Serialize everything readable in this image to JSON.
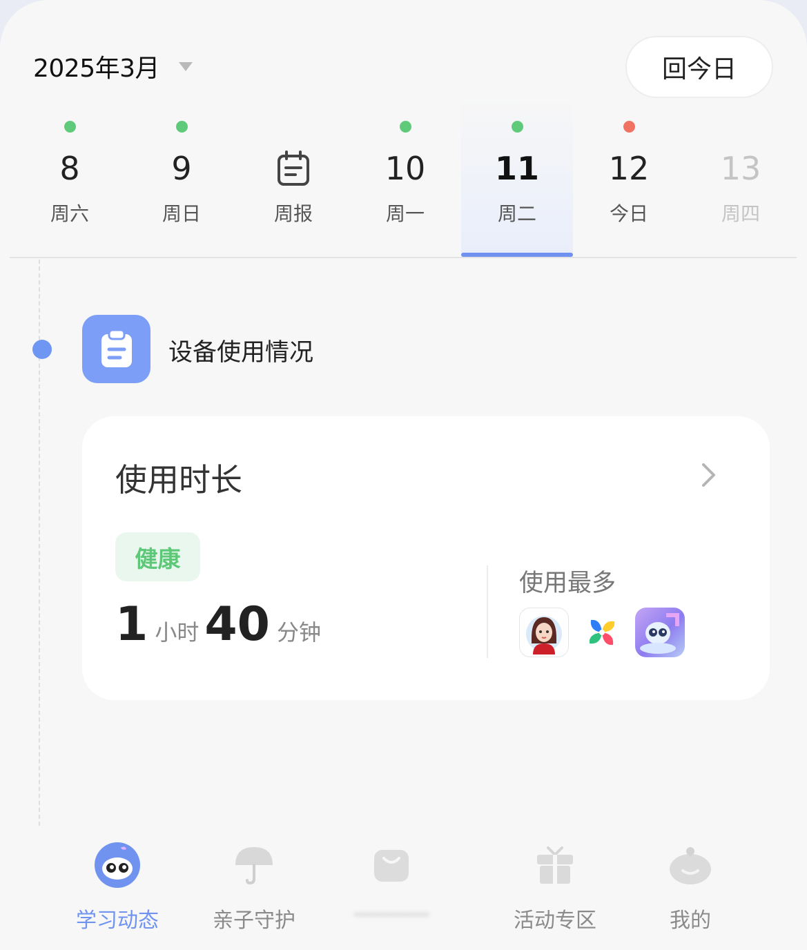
{
  "header": {
    "month_label": "2025年3月",
    "today_button": "回今日"
  },
  "days": [
    {
      "num": "8",
      "label": "周六",
      "dot": "green",
      "state": "normal"
    },
    {
      "num": "9",
      "label": "周日",
      "dot": "green",
      "state": "normal"
    },
    {
      "num": "",
      "label": "周报",
      "dot": "none",
      "state": "report",
      "icon": "calendar-report-icon"
    },
    {
      "num": "10",
      "label": "周一",
      "dot": "green",
      "state": "normal"
    },
    {
      "num": "11",
      "label": "周二",
      "dot": "green",
      "state": "selected"
    },
    {
      "num": "12",
      "label": "今日",
      "dot": "red",
      "state": "normal"
    },
    {
      "num": "13",
      "label": "周四",
      "dot": "none",
      "state": "disabled"
    }
  ],
  "section": {
    "title": "设备使用情况",
    "icon": "clipboard-icon"
  },
  "card": {
    "title": "使用时长",
    "badge": "健康",
    "hours": "1",
    "hours_unit": "小时",
    "minutes": "40",
    "minutes_unit": "分钟",
    "most_used_label": "使用最多",
    "apps": [
      "avatar-app-icon",
      "pinwheel-app-icon",
      "robot-app-icon"
    ]
  },
  "tabs": [
    {
      "label": "学习动态",
      "icon": "owl-mascot-icon",
      "active": true
    },
    {
      "label": "亲子守护",
      "icon": "umbrella-icon",
      "active": false
    },
    {
      "label": "",
      "icon": "shopping-bag-icon",
      "active": false
    },
    {
      "label": "活动专区",
      "icon": "gift-icon",
      "active": false
    },
    {
      "label": "我的",
      "icon": "profile-face-icon",
      "active": false
    }
  ],
  "colors": {
    "accent": "#6f93ef",
    "healthy_green": "#5cc878",
    "dot_green": "#5fcb7a",
    "dot_red": "#f07263"
  }
}
